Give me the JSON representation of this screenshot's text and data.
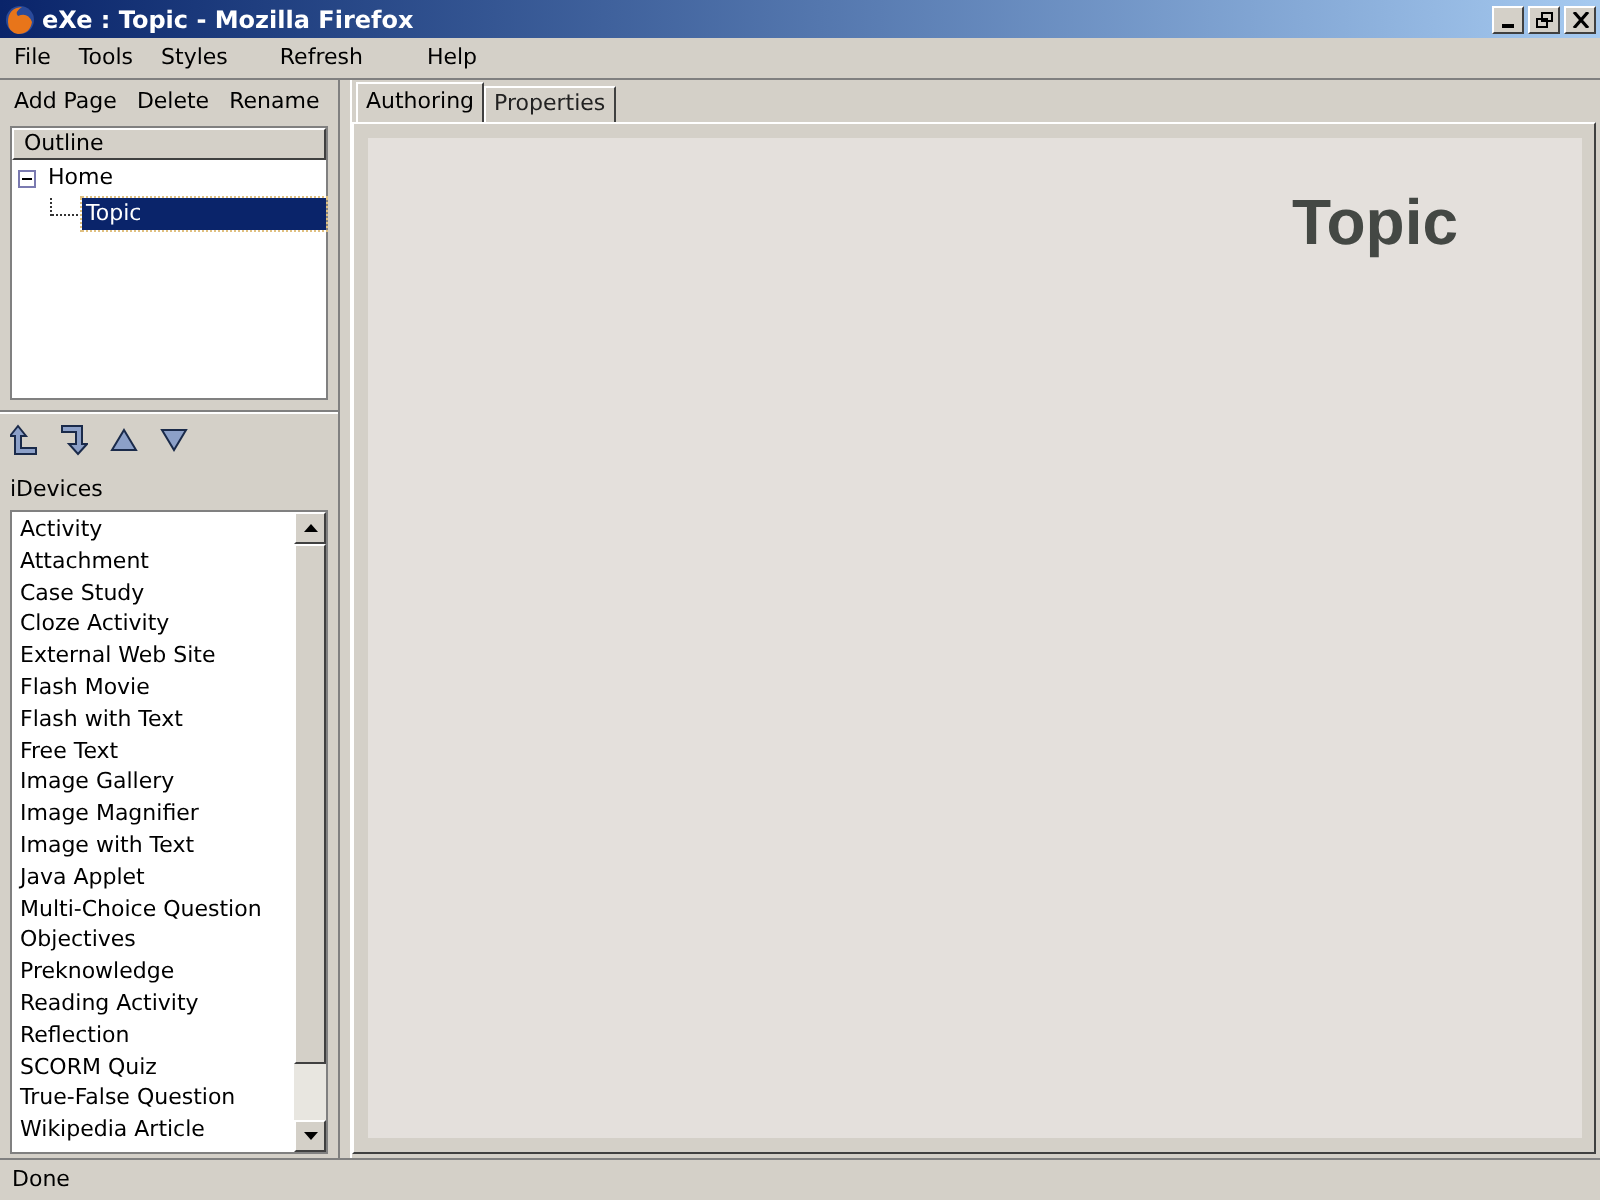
{
  "window": {
    "title": "eXe : Topic - Mozilla Firefox"
  },
  "menu": [
    "File",
    "Tools",
    "Styles",
    "Refresh",
    "Help"
  ],
  "toolbar": [
    "Add Page",
    "Delete",
    "Rename"
  ],
  "outline": {
    "header": "Outline",
    "items": [
      {
        "label": "Home",
        "expanded": true,
        "selected": false,
        "children": [
          {
            "label": "Topic",
            "selected": true
          }
        ]
      }
    ]
  },
  "idevices": {
    "label": "iDevices",
    "items": [
      "Activity",
      "Attachment",
      "Case Study",
      "Cloze Activity",
      "External Web Site",
      "Flash Movie",
      "Flash with Text",
      "Free Text",
      "Image Gallery",
      "Image Magnifier",
      "Image with Text",
      "Java Applet",
      "Multi-Choice Question",
      "Objectives",
      "Preknowledge",
      "Reading Activity",
      "Reflection",
      "SCORM Quiz",
      "True-False Question",
      "Wikipedia Article"
    ]
  },
  "tabs": [
    {
      "label": "Authoring",
      "selected": true
    },
    {
      "label": "Properties",
      "selected": false
    }
  ],
  "content": {
    "heading": "Topic"
  },
  "status_bar": "Done"
}
